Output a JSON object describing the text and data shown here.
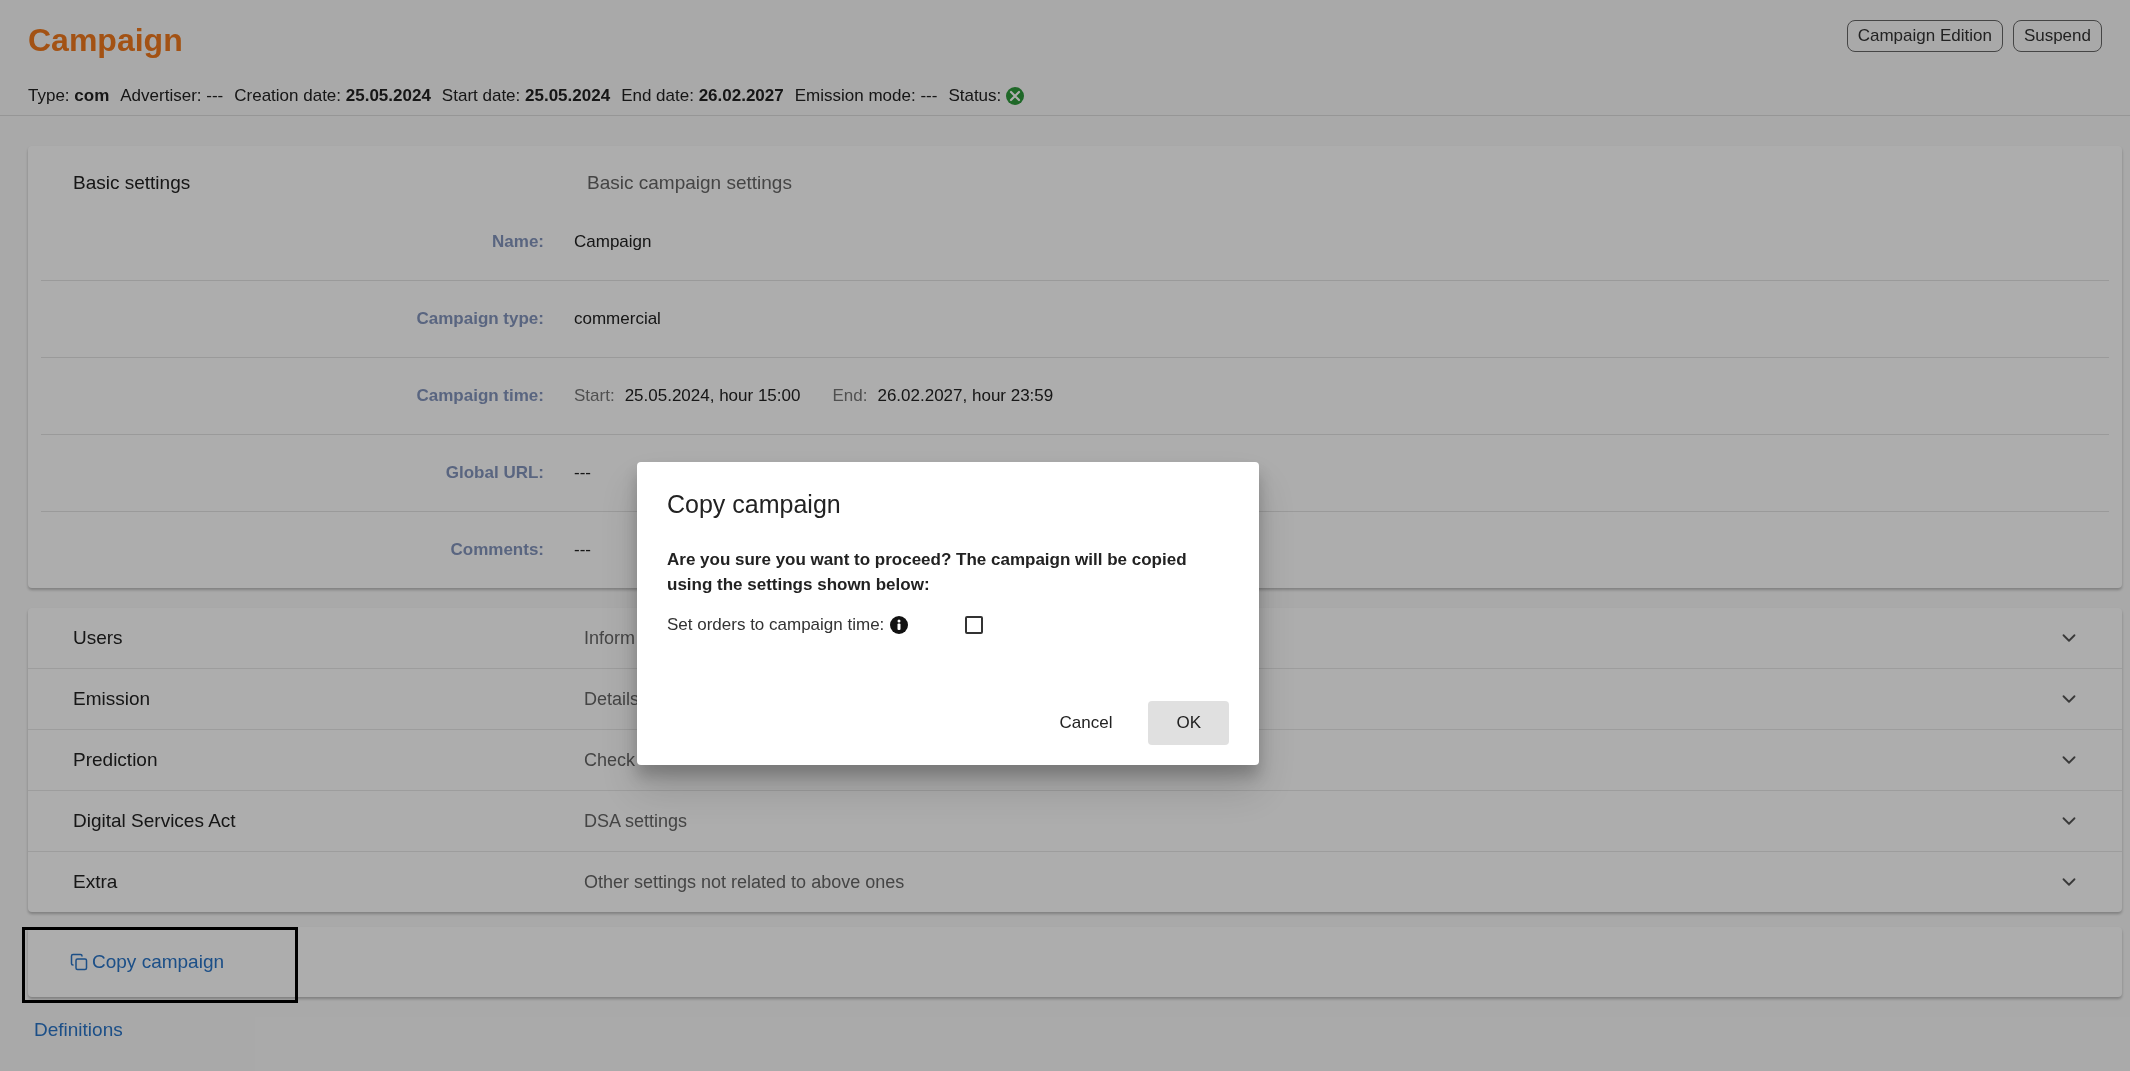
{
  "header": {
    "title": "Campaign",
    "meta": [
      {
        "text": "Type: **com**"
      },
      {
        "text": "Advertiser: ---"
      },
      {
        "text": "Creation date: **25.05.2024**"
      },
      {
        "text": "Start date: **25.05.2024**"
      },
      {
        "text": "End date: **26.02.2027**"
      },
      {
        "text": "Emission mode: ---"
      }
    ],
    "status_label": "Status:",
    "actions": [
      "Campaign Edition",
      "Suspend"
    ]
  },
  "basic_settings": {
    "title": "Basic settings",
    "description": "Basic campaign settings",
    "fields": [
      {
        "label": "Name:",
        "kind": "text",
        "value": "Campaign"
      },
      {
        "label": "Campaign type:",
        "kind": "text",
        "value": "commercial"
      },
      {
        "label": "Campaign time:",
        "kind": "range",
        "start_label": "Start:",
        "start": "25.05.2024, hour 15:00",
        "end_label": "End:",
        "end": "26.02.2027, hour 23:59"
      },
      {
        "label": "Global URL:",
        "kind": "text",
        "value": "---"
      },
      {
        "label": "Comments:",
        "kind": "text",
        "value": "---"
      }
    ]
  },
  "sections": [
    {
      "title": "Users",
      "description": "Inform",
      "expanded": false
    },
    {
      "title": "Emission",
      "description": "Details",
      "expanded": false
    },
    {
      "title": "Prediction",
      "description": "Check",
      "expanded": false
    },
    {
      "title": "Digital Services Act",
      "description": "DSA settings",
      "expanded": false
    },
    {
      "title": "Extra",
      "description": "Other settings not related to above ones",
      "expanded": false
    }
  ],
  "copy_link": "Copy campaign",
  "definitions_link": "Definitions",
  "dialog": {
    "title": "Copy campaign",
    "message": "Are you sure you want to proceed? The campaign will be copied using the settings shown below:",
    "option": {
      "label": "Set orders to campaign time:",
      "checked": false
    },
    "buttons": [
      {
        "label": "Cancel",
        "kind": "text"
      },
      {
        "label": "OK",
        "kind": "filled"
      }
    ]
  }
}
